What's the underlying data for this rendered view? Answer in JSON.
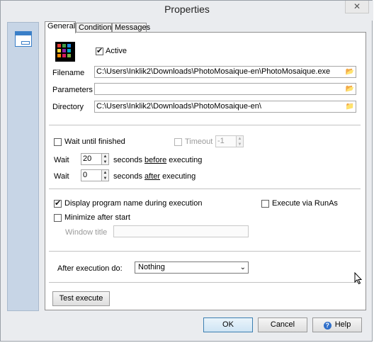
{
  "window": {
    "title": "Properties",
    "close_glyph": "✕"
  },
  "sidebar": {
    "items": [
      {
        "icon": "window-icon"
      }
    ]
  },
  "tabs": [
    {
      "label": "General",
      "active": true
    },
    {
      "label": "Conditions",
      "active": false
    },
    {
      "label": "Messages",
      "active": false
    }
  ],
  "general": {
    "active_label": "Active",
    "active_checked": true,
    "filename_label": "Filename",
    "filename_value": "C:\\Users\\Inklik2\\Downloads\\PhotoMosaique-en\\PhotoMosaique.exe",
    "parameters_label": "Parameters",
    "parameters_value": "",
    "directory_label": "Directory",
    "directory_value": "C:\\Users\\Inklik2\\Downloads\\PhotoMosaique-en\\",
    "wait_until_finished_label": "Wait until finished",
    "wait_until_finished_checked": false,
    "timeout_label": "Timeout",
    "timeout_value": "-1",
    "wait_label_1": "Wait",
    "wait_before_value": "20",
    "seconds_text_1": "seconds ",
    "before_text": "before",
    "executing_text_1": " executing",
    "wait_label_2": "Wait",
    "wait_after_value": "0",
    "seconds_text_2": "seconds ",
    "after_text": "after",
    "executing_text_2": " executing",
    "display_name_label": "Display program name during execution",
    "display_name_checked": true,
    "execute_runas_label": "Execute via RunAs",
    "execute_runas_checked": false,
    "minimize_label": "Minimize after start",
    "minimize_checked": false,
    "window_title_label": "Window title",
    "window_title_value": "",
    "after_exec_label": "After execution do:",
    "after_exec_value": "Nothing",
    "test_execute_label": "Test execute"
  },
  "footer": {
    "ok_label": "OK",
    "cancel_label": "Cancel",
    "help_label": "Help"
  },
  "colors": {
    "sidebar_bg": "#c7d5e6",
    "accent": "#3a7fc8",
    "window_bg": "#eaecef"
  }
}
